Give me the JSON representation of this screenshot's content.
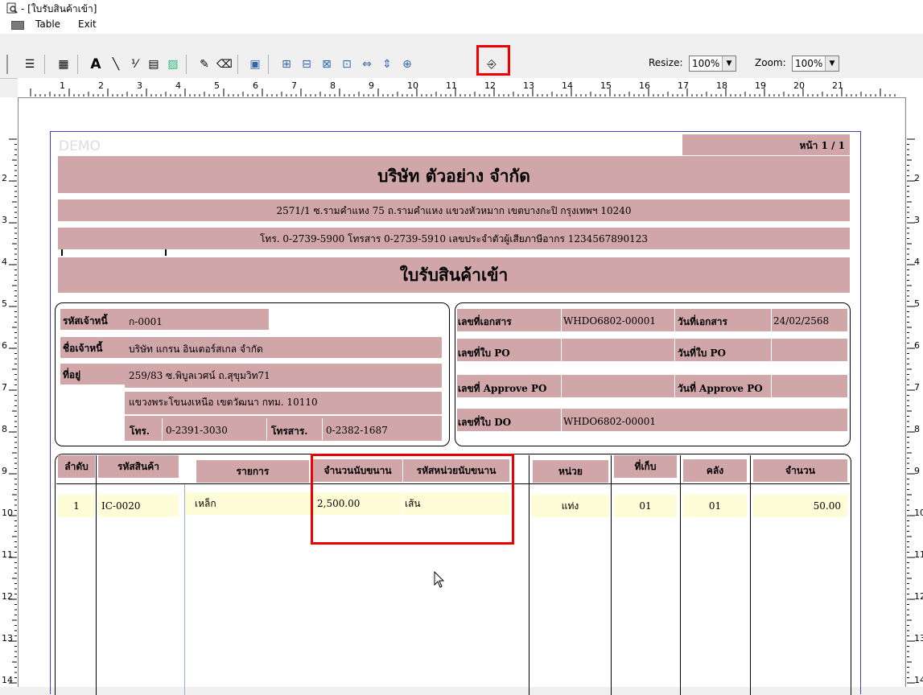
{
  "window": {
    "title": " - [ใบรับสินค้าเข้า]"
  },
  "menu": {
    "items": [
      "Table",
      "Exit"
    ]
  },
  "toolbar": {
    "resize_label": "Resize:",
    "resize_value": "100%",
    "zoom_label": "Zoom:",
    "zoom_value": "100%",
    "buttons": [
      "align-icon",
      "table-icon",
      "text-icon",
      "line-icon",
      "percent-icon",
      "field-icon",
      "image-icon",
      "label-icon",
      "eraser-icon",
      "chart-icon",
      "group-icon",
      "align-left-icon",
      "align-right-icon",
      "align-top-icon",
      "hspace-icon",
      "vspace-icon",
      "fit-icon",
      "exit-icon"
    ]
  },
  "ruler": {
    "h": [
      "1",
      "2",
      "3",
      "4",
      "5",
      "6",
      "7",
      "8",
      "9",
      "10",
      "11",
      "12",
      "13",
      "14",
      "15",
      "16",
      "17",
      "18",
      "19",
      "20",
      "21"
    ],
    "v": [
      "2",
      "3",
      "4",
      "5",
      "6",
      "7",
      "8",
      "9",
      "10",
      "11",
      "12",
      "13",
      "14"
    ]
  },
  "report": {
    "watermark": "DEMO",
    "page": "หน้า 1 / 1",
    "company": "บริษัท ตัวอย่าง จำกัด",
    "address": "2571/1 ซ.รามคำแหง 75 ถ.รามคำแหง แขวงหัวหมาก เขตบางกะปิ กรุงเทพฯ 10240",
    "contact": "โทร. 0-2739-5900   โทรสาร 0-2739-5910   เลขประจำตัวผู้เสียภาษีอากร 1234567890123",
    "doc_title": "ใบรับสินค้าเข้า",
    "supplier": {
      "code_label": "รหัสเจ้าหนี้",
      "code": "ก-0001",
      "name_label": "ชื่อเจ้าหนี้",
      "name": "บริษัท แกรน อินเตอร์สเกล จำกัด",
      "addr_label": "ที่อยู่",
      "addr1": "259/83 ซ.พิบูลเวศน์ ถ.สุขุมวิท71",
      "addr2": "แขวงพระโขนงเหนือ เขตวัฒนา กทม.  10110",
      "tel_label": "โทร.",
      "tel": "0-2391-3030",
      "fax_label": "โทรสาร.",
      "fax": "0-2382-1687"
    },
    "doc": {
      "no_label": "เลขที่เอกสาร",
      "no": "WHDO6802-00001",
      "date_label": "วันที่เอกสาร",
      "date": "24/02/2568",
      "po_label": "เลขที่ใบ PO",
      "po": "",
      "po_date_label": "วันที่ใบ PO",
      "po_date": "",
      "appr_label": "เลขที่ Approve PO",
      "appr": "",
      "appr_date_label": "วันที่ Approve PO",
      "appr_date": "",
      "do_label": "เลขที่ใบ DO",
      "do": "WHDO6802-00001"
    },
    "table": {
      "headers": [
        "ลำดับ",
        "รหัสสินค้า",
        "รายการ",
        "จำนวนนับขนาน",
        "รหัสหน่วยนับขนาน",
        "หน่วย",
        "ที่เก็บ",
        "คลัง",
        "จำนวน"
      ],
      "rows": [
        [
          "1",
          "IC-0020",
          "เหล็ก",
          "2,500.00",
          "เส้น",
          "แท่ง",
          "01",
          "01",
          "50.00"
        ]
      ]
    }
  },
  "colors": {
    "header_pink": "#d1a6a9",
    "row_yellow": "#fffcd8",
    "highlight": "#e00000"
  }
}
